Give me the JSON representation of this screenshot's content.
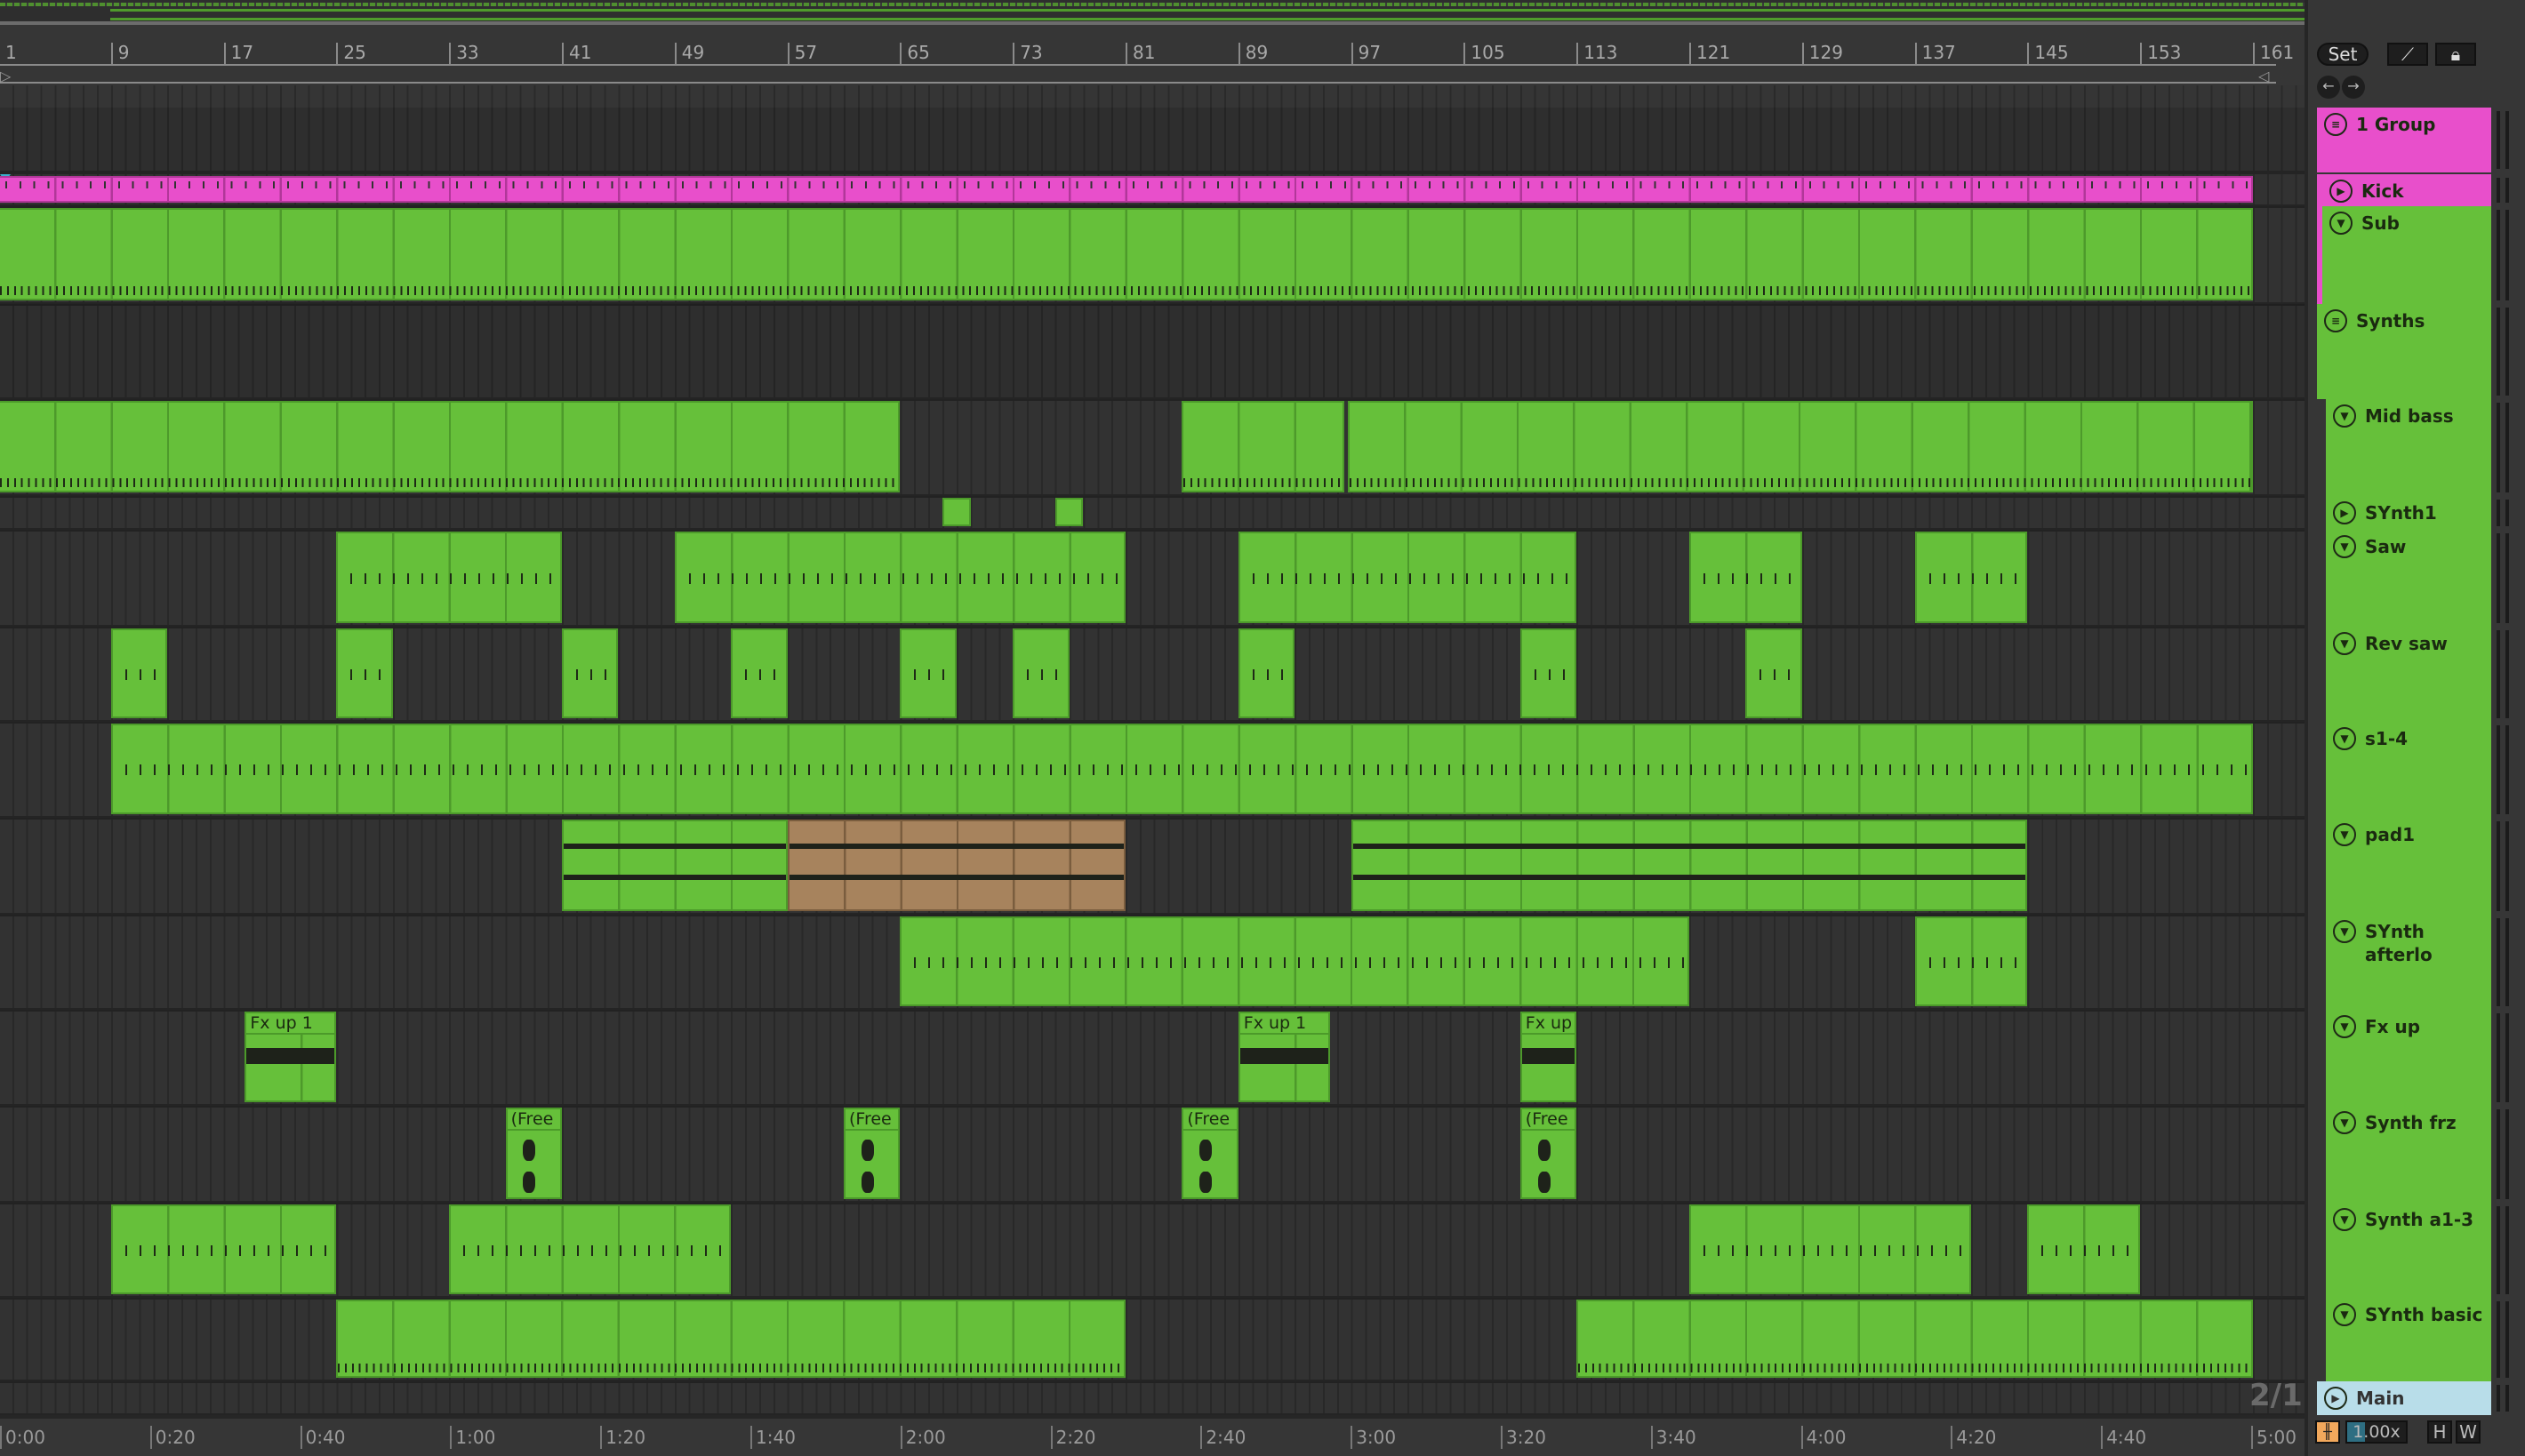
{
  "ruler": {
    "bar_labels": [
      "1",
      "9",
      "17",
      "25",
      "33",
      "41",
      "49",
      "57",
      "65",
      "73",
      "81",
      "89",
      "97",
      "105",
      "113",
      "121",
      "129",
      "137",
      "145",
      "153",
      "161"
    ]
  },
  "time_ruler": {
    "labels": [
      "0:00",
      "0:20",
      "0:40",
      "1:00",
      "1:20",
      "1:40",
      "2:00",
      "2:20",
      "2:40",
      "3:00",
      "3:20",
      "3:40",
      "4:00",
      "4:20",
      "4:40",
      "5:00"
    ]
  },
  "zoom_indicator": "2/1",
  "controls": {
    "set_label": "Set",
    "draw_icon": "draw-mode-icon",
    "lock_icon": "lock-icon",
    "back_icon": "arrow-left-icon",
    "forward_icon": "arrow-right-icon",
    "speed": "1.00x",
    "h_label": "H",
    "w_label": "W",
    "wave_icon": "waveform-icon"
  },
  "colors": {
    "green": "#66c03a",
    "pink": "#e84fcb",
    "brown": "#a7835d",
    "main": "#b8dde9"
  },
  "tracks": [
    {
      "name": "1 Group",
      "kind": "group",
      "color": "#e84fcb",
      "clips": []
    },
    {
      "name": "Kick",
      "kind": "audio",
      "color": "#e84fcb",
      "child": true,
      "clips": [
        {
          "start": 1,
          "end": 161,
          "style": "pink"
        }
      ]
    },
    {
      "name": "Sub",
      "kind": "midi",
      "color": "#66c03a",
      "child": true,
      "clips": [
        {
          "start": 1,
          "end": 161,
          "style": "ticks"
        }
      ]
    },
    {
      "name": "Synths",
      "kind": "group",
      "color": "#66c03a",
      "clips": []
    },
    {
      "name": "Mid bass",
      "kind": "midi",
      "color": "#66c03a",
      "child": true,
      "clips": [
        {
          "start": 1,
          "end": 65,
          "style": "ticks"
        },
        {
          "start": 85,
          "end": 96.5,
          "style": "ticks"
        },
        {
          "start": 96.75,
          "end": 161,
          "style": "ticks"
        }
      ]
    },
    {
      "name": "SYnth1",
      "kind": "audio",
      "color": "#66c03a",
      "child": true,
      "clips": [
        {
          "start": 68,
          "end": 70
        },
        {
          "start": 76,
          "end": 78
        }
      ]
    },
    {
      "name": "Saw",
      "kind": "midi",
      "color": "#66c03a",
      "child": true,
      "clips": [
        {
          "start": 25,
          "end": 41,
          "style": "notes"
        },
        {
          "start": 49,
          "end": 81,
          "style": "notes"
        },
        {
          "start": 89,
          "end": 113,
          "style": "notes"
        },
        {
          "start": 121,
          "end": 129,
          "style": "notes"
        },
        {
          "start": 137,
          "end": 145,
          "style": "notes"
        }
      ]
    },
    {
      "name": "Rev saw",
      "kind": "midi",
      "color": "#66c03a",
      "child": true,
      "clips": [
        {
          "start": 9,
          "end": 13,
          "style": "notes"
        },
        {
          "start": 25,
          "end": 29,
          "style": "notes"
        },
        {
          "start": 41,
          "end": 45,
          "style": "notes"
        },
        {
          "start": 53,
          "end": 57,
          "style": "notes"
        },
        {
          "start": 65,
          "end": 69,
          "style": "notes"
        },
        {
          "start": 73,
          "end": 77,
          "style": "notes"
        },
        {
          "start": 89,
          "end": 93,
          "style": "notes"
        },
        {
          "start": 109,
          "end": 113,
          "style": "notes"
        },
        {
          "start": 125,
          "end": 129,
          "style": "notes"
        }
      ]
    },
    {
      "name": "s1-4",
      "kind": "midi",
      "color": "#66c03a",
      "child": true,
      "clips": [
        {
          "start": 9,
          "end": 161,
          "style": "notes"
        }
      ]
    },
    {
      "name": "pad1",
      "kind": "midi",
      "color": "#66c03a",
      "child": true,
      "clips": [
        {
          "start": 41,
          "end": 57,
          "style": "pad"
        },
        {
          "start": 57,
          "end": 81,
          "style": "brown"
        },
        {
          "start": 97,
          "end": 145,
          "style": "pad"
        }
      ]
    },
    {
      "name": "SYnth afterlo",
      "kind": "midi",
      "color": "#66c03a",
      "child": true,
      "clips": [
        {
          "start": 65,
          "end": 121,
          "style": "notes"
        },
        {
          "start": 137,
          "end": 145,
          "style": "notes"
        }
      ]
    },
    {
      "name": "Fx up",
      "kind": "midi",
      "color": "#66c03a",
      "child": true,
      "clips": [
        {
          "start": 18.5,
          "end": 25,
          "label": "Fx up 1",
          "style": "band"
        },
        {
          "start": 89,
          "end": 95.5,
          "label": "Fx up 1",
          "style": "band"
        },
        {
          "start": 109,
          "end": 113,
          "label": "Fx up",
          "style": "band"
        }
      ]
    },
    {
      "name": "Synth frz",
      "kind": "midi",
      "color": "#66c03a",
      "child": true,
      "clips": [
        {
          "start": 37,
          "end": 41,
          "label": "(Free",
          "style": "wave"
        },
        {
          "start": 61,
          "end": 65,
          "label": "(Free",
          "style": "wave"
        },
        {
          "start": 85,
          "end": 89,
          "label": "(Free",
          "style": "wave"
        },
        {
          "start": 109,
          "end": 113,
          "label": "(Free",
          "style": "wave"
        }
      ]
    },
    {
      "name": "Synth a1-3",
      "kind": "midi",
      "color": "#66c03a",
      "child": true,
      "clips": [
        {
          "start": 9,
          "end": 25,
          "style": "notes"
        },
        {
          "start": 33,
          "end": 53,
          "style": "notes"
        },
        {
          "start": 121,
          "end": 141,
          "style": "notes"
        },
        {
          "start": 145,
          "end": 153,
          "style": "notes"
        }
      ]
    },
    {
      "name": "SYnth basic",
      "kind": "midi",
      "color": "#66c03a",
      "child": true,
      "clips": [
        {
          "start": 25,
          "end": 81,
          "style": "ticks"
        },
        {
          "start": 113,
          "end": 161,
          "style": "ticks"
        }
      ]
    },
    {
      "name": "Main",
      "kind": "main",
      "color": "#b8dde9",
      "clips": []
    }
  ]
}
